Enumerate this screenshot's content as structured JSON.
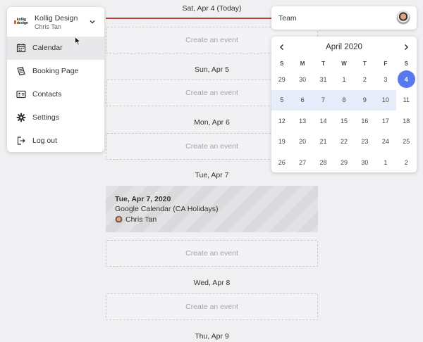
{
  "org_menu": {
    "org_name": "Kollig Design",
    "user_name": "Chris Tan",
    "logo_text": "kollig design",
    "items": [
      {
        "label": "Calendar",
        "icon": "calendar-icon",
        "active": true
      },
      {
        "label": "Booking Page",
        "icon": "booking-page-icon",
        "active": false
      },
      {
        "label": "Contacts",
        "icon": "contacts-icon",
        "active": false
      },
      {
        "label": "Settings",
        "icon": "gear-icon",
        "active": false
      },
      {
        "label": "Log out",
        "icon": "logout-icon",
        "active": false
      }
    ]
  },
  "agenda": {
    "days": [
      {
        "label": "Sat, Apr 4 (Today)"
      },
      {
        "label": "Sun, Apr 5"
      },
      {
        "label": "Mon, Apr 6"
      },
      {
        "label": "Tue, Apr 7"
      },
      {
        "label": "Wed, Apr 8"
      },
      {
        "label": "Thu, Apr 9"
      }
    ],
    "create_label": "Create an event",
    "event": {
      "date": "Tue, Apr 7, 2020",
      "title": "Google Calendar (CA Holidays)",
      "owner": "Chris Tan"
    }
  },
  "team": {
    "label": "Team"
  },
  "calendar": {
    "month": "April 2020",
    "dow": [
      "S",
      "M",
      "T",
      "W",
      "T",
      "F",
      "S"
    ],
    "weeks": [
      [
        "29",
        "30",
        "31",
        "1",
        "2",
        "3",
        "4"
      ],
      [
        "5",
        "6",
        "7",
        "8",
        "9",
        "10",
        "11"
      ],
      [
        "12",
        "13",
        "14",
        "15",
        "16",
        "17",
        "18"
      ],
      [
        "19",
        "20",
        "21",
        "22",
        "23",
        "24",
        "25"
      ],
      [
        "26",
        "27",
        "28",
        "29",
        "30",
        "1",
        "2"
      ]
    ],
    "selected": "4",
    "accent": "#5878ee",
    "week_highlight": "#e6ecf9"
  },
  "colors": {
    "today_line": "#b83c3c",
    "brand": "#e8632b"
  }
}
